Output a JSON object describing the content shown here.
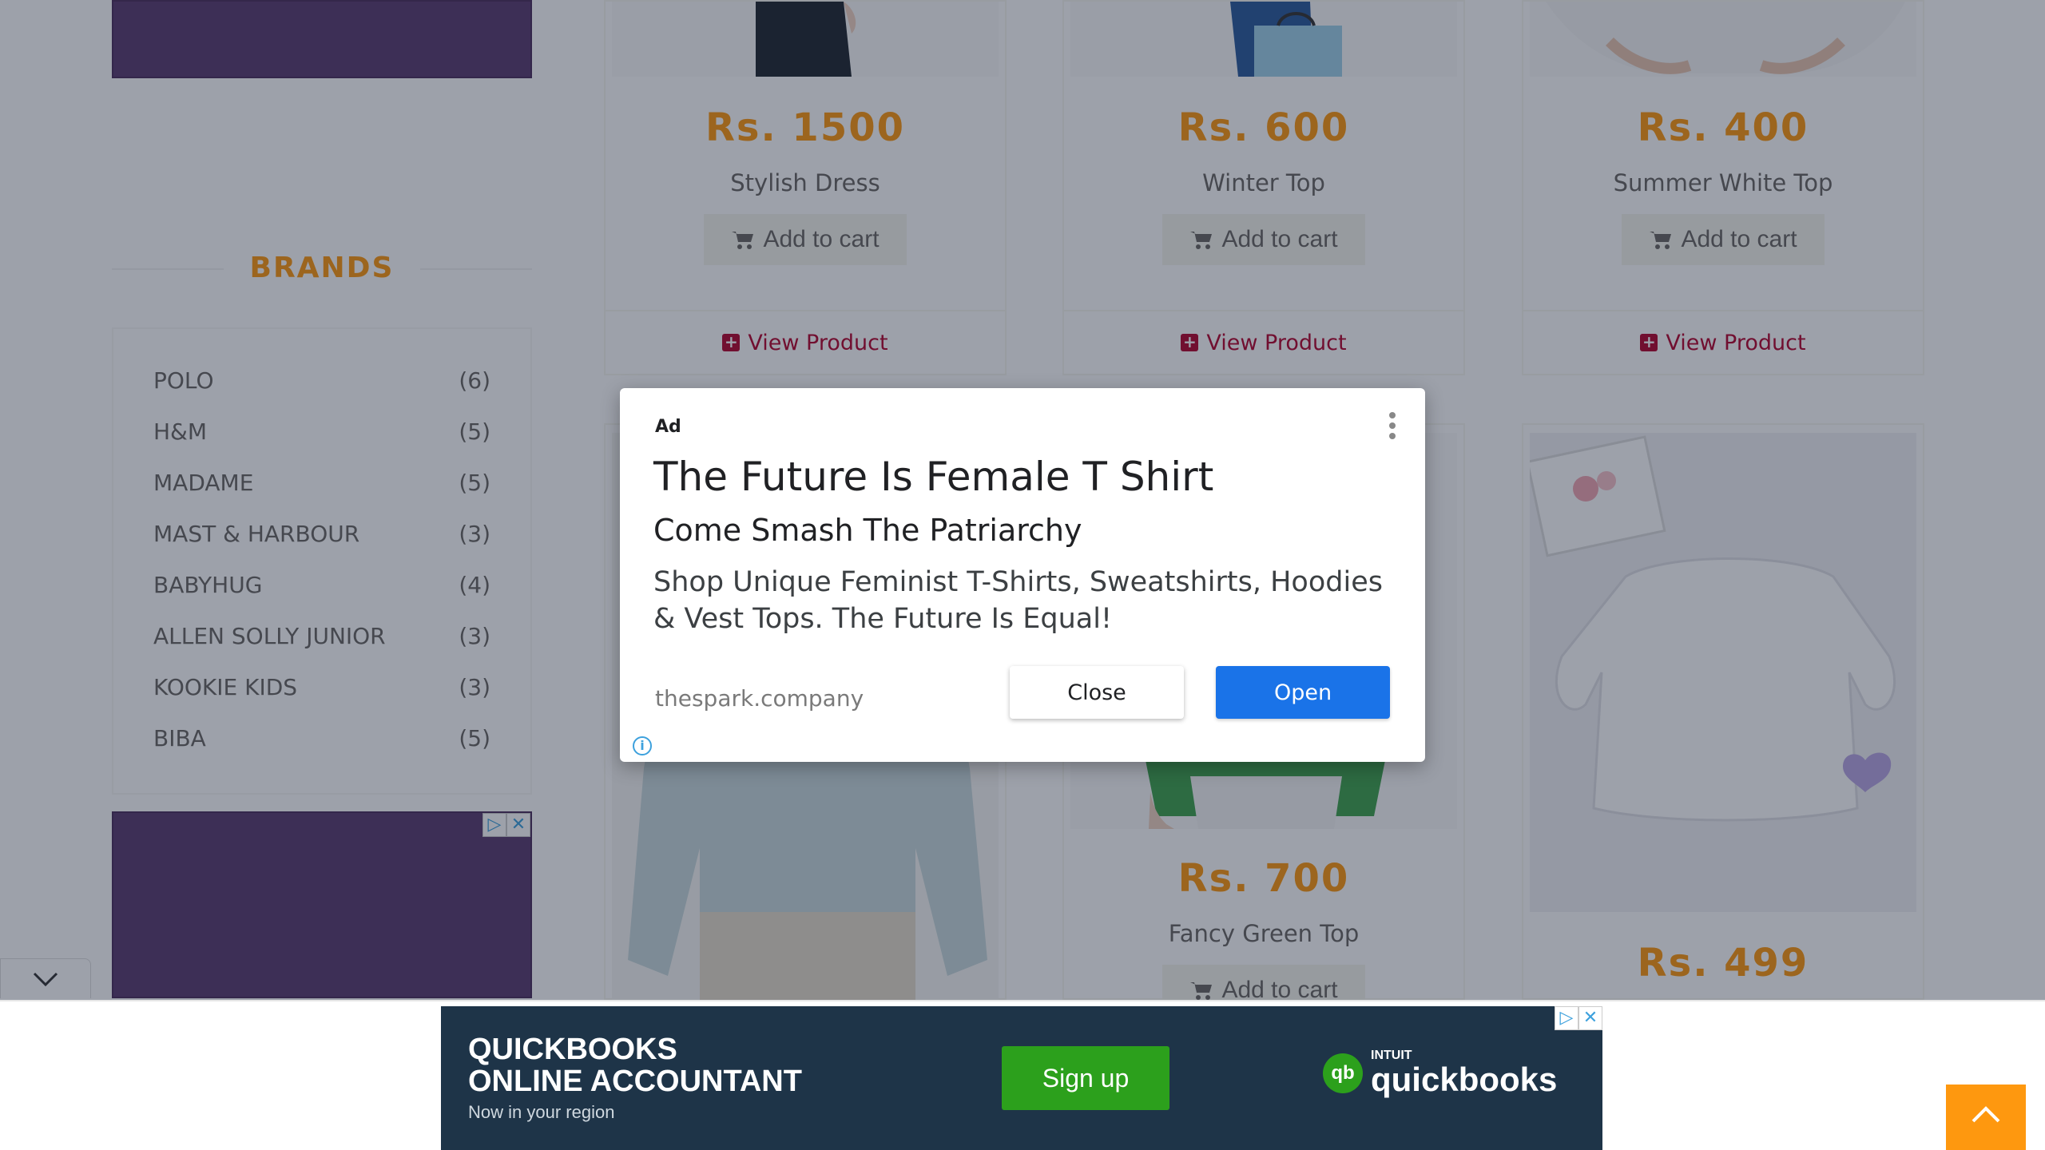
{
  "sidebar": {
    "brands_title": "BRANDS",
    "brands": [
      {
        "name": "POLO",
        "count": "(6)"
      },
      {
        "name": "H&M",
        "count": "(5)"
      },
      {
        "name": "MADAME",
        "count": "(5)"
      },
      {
        "name": "MAST & HARBOUR",
        "count": "(3)"
      },
      {
        "name": "BABYHUG",
        "count": "(4)"
      },
      {
        "name": "ALLEN SOLLY JUNIOR",
        "count": "(3)"
      },
      {
        "name": "KOOKIE KIDS",
        "count": "(3)"
      },
      {
        "name": "BIBA",
        "count": "(5)"
      }
    ]
  },
  "products_row1": [
    {
      "price": "Rs. 1500",
      "name": "Stylish Dress",
      "cart_label": "Add to cart",
      "view_label": "View Product"
    },
    {
      "price": "Rs. 600",
      "name": "Winter Top",
      "cart_label": "Add to cart",
      "view_label": "View Product"
    },
    {
      "price": "Rs. 400",
      "name": "Summer White Top",
      "cart_label": "Add to cart",
      "view_label": "View Product"
    }
  ],
  "products_row2": [
    {
      "price": "Rs. 700",
      "name": "Fancy Green Top",
      "cart_label": "Add to cart"
    },
    {
      "price": "Rs. 499"
    }
  ],
  "ad_dialog": {
    "ad_label": "Ad",
    "headline": "The Future Is Female T Shirt",
    "subheadline": "Come Smash The Patriarchy",
    "body": "Shop Unique Feminist T-Shirts, Sweatshirts, Hoodies & Vest Tops. The Future Is Equal!",
    "domain": "thespark.company",
    "close_label": "Close",
    "open_label": "Open",
    "info_glyph": "i"
  },
  "bottom_ad": {
    "title_line1": "QUICKBOOKS",
    "title_line2": "ONLINE ACCOUNTANT",
    "subtitle": "Now in your region",
    "signup_label": "Sign up",
    "logo_mark": "qb",
    "logo_intuit": "INTUIT",
    "logo_brand": "quickbooks"
  },
  "ad_choices": {
    "play": "▷",
    "close": "✕"
  },
  "colors": {
    "accent_orange": "#fe980f",
    "link_red": "#b3042e",
    "ad_purple": "#5b3b6e",
    "dialog_blue": "#1a73e8",
    "qb_navy": "#1e3448",
    "qb_green": "#2ca01c"
  }
}
